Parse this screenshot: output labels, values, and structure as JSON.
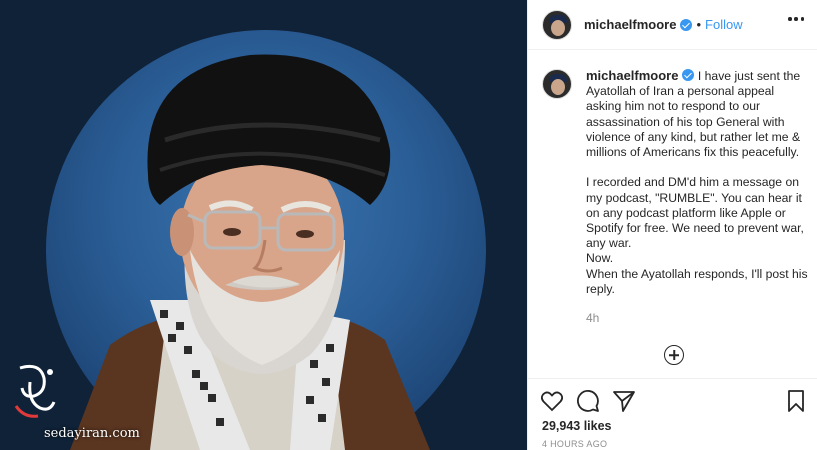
{
  "post": {
    "username": "michaelfmoore",
    "separator": "•",
    "follow_label": "Follow",
    "caption": "I have just sent the Ayatollah of Iran a personal appeal asking him not to respond to our assassination of his top General with violence of any kind, but rather let me & millions of Americans fix this peacefully.\n\nI recorded and DM'd him a message on my podcast, \"RUMBLE\". You can hear it on any podcast platform like Apple or Spotify for free. We need to prevent war, any war.\nNow.\nWhen the Ayatollah responds, I'll post his reply.",
    "caption_time": "4h",
    "likes": "29,943 likes",
    "posted_ago": "4 HOURS AGO"
  },
  "watermark": {
    "site": "sedayiran.com"
  },
  "icons": {
    "verified": "verified-badge-icon",
    "more": "more-options-icon",
    "add_comment": "add-comment-icon",
    "like": "heart-icon",
    "comment": "comment-icon",
    "share": "share-icon",
    "save": "bookmark-icon"
  },
  "colors": {
    "accent": "#3897f0",
    "media_bg": "#0f2238",
    "circle_bg": "#2a5d95",
    "muted_text": "#8e8e8e"
  }
}
